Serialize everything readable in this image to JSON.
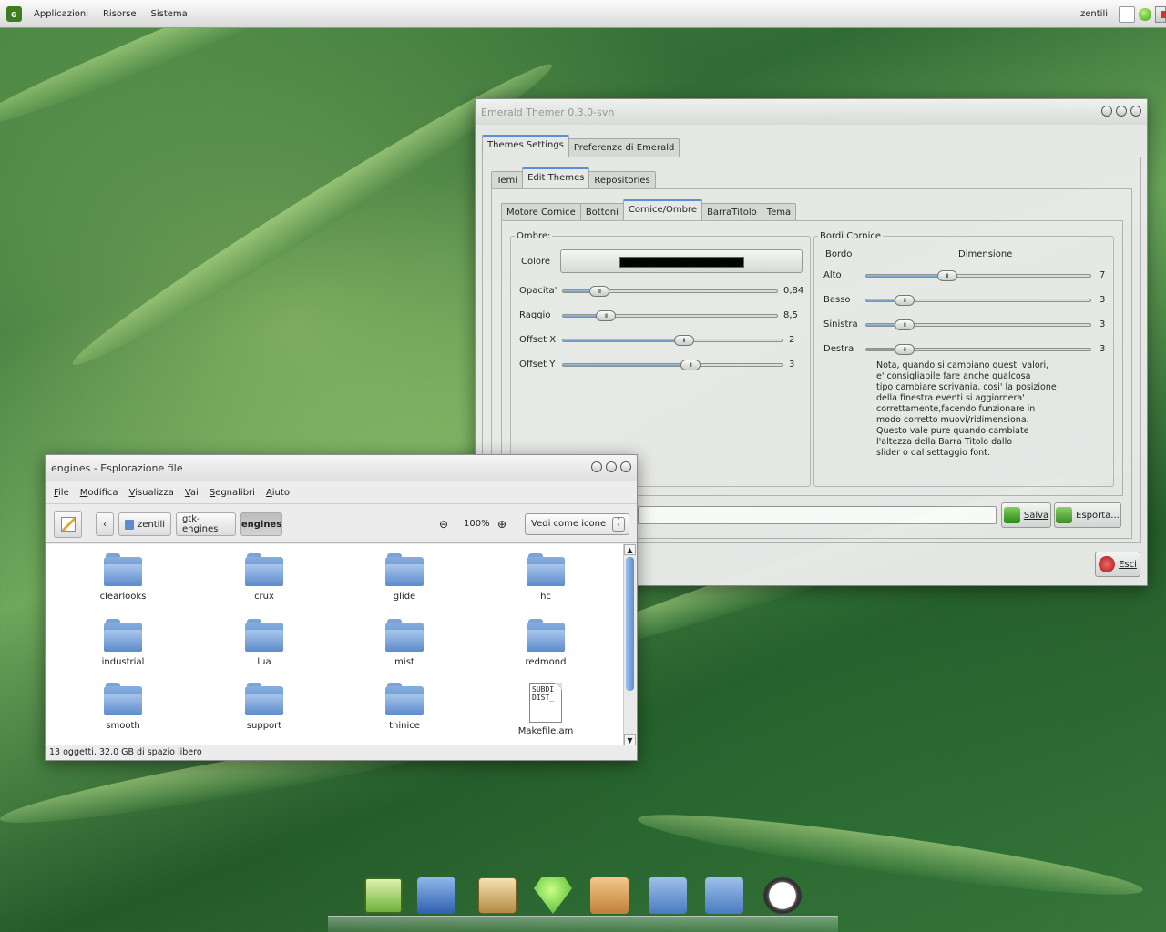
{
  "top_panel": {
    "menus": [
      "Applicazioni",
      "Risorse",
      "Sistema"
    ],
    "user": "zentili"
  },
  "emerald": {
    "title": "Emerald Themer 0.3.0-svn",
    "main_tabs": [
      "Themes Settings",
      "Preferenze di Emerald"
    ],
    "sub_tabs": [
      "Temi",
      "Edit Themes",
      "Repositories"
    ],
    "edit_tabs": [
      "Motore Cornice",
      "Bottoni",
      "Cornice/Ombre",
      "BarraTitolo",
      "Tema"
    ],
    "ombre": {
      "title": "Ombre:",
      "colore_label": "Colore",
      "colore_value": "#000000",
      "sliders": [
        {
          "label": "Opacita'",
          "value": "0,84",
          "fraction": 0.17
        },
        {
          "label": "Raggio",
          "value": "8,5",
          "fraction": 0.2
        },
        {
          "label": "Offset X",
          "value": "2",
          "fraction": 0.55
        },
        {
          "label": "Offset Y",
          "value": "3",
          "fraction": 0.58
        }
      ]
    },
    "bordi": {
      "title": "Bordi Cornice",
      "col_bordo": "Bordo",
      "col_dim": "Dimensione",
      "sliders": [
        {
          "label": "Alto",
          "value": "7",
          "fraction": 0.36
        },
        {
          "label": "Basso",
          "value": "3",
          "fraction": 0.17
        },
        {
          "label": "Sinistra",
          "value": "3",
          "fraction": 0.17
        },
        {
          "label": "Destra",
          "value": "3",
          "fraction": 0.17
        }
      ],
      "note": "Nota, quando si cambiano questi valori,\ne' consigliabile fare anche qualcosa\ntipo cambiare scrivania, cosi' la posizione\ndella finestra eventi si aggiornera'\ncorrettamente,facendo funzionare in\nmodo corretto muovi/ridimensiona.\nQuesto vale pure quando cambiate\nl'altezza della Barra Titolo dallo\nslider o dal settaggio font."
    },
    "buttons": {
      "salva": "Salva",
      "esporta": "Esporta...",
      "esci": "Esci"
    }
  },
  "nautilus": {
    "title": "engines - Esplorazione file",
    "menu": [
      "File",
      "Modifica",
      "Visualizza",
      "Vai",
      "Segnalibri",
      "Aiuto"
    ],
    "path": [
      "zentili",
      "gtk-engines",
      "engines"
    ],
    "back_label": "‹",
    "zoom": "100%",
    "view_mode": "Vedi come icone",
    "files": [
      {
        "name": "clearlooks",
        "type": "folder"
      },
      {
        "name": "crux",
        "type": "folder"
      },
      {
        "name": "glide",
        "type": "folder"
      },
      {
        "name": "hc",
        "type": "folder"
      },
      {
        "name": "industrial",
        "type": "folder"
      },
      {
        "name": "lua",
        "type": "folder"
      },
      {
        "name": "mist",
        "type": "folder"
      },
      {
        "name": "redmond",
        "type": "folder"
      },
      {
        "name": "smooth",
        "type": "folder"
      },
      {
        "name": "support",
        "type": "folder"
      },
      {
        "name": "thinice",
        "type": "folder"
      },
      {
        "name": "Makefile.am",
        "type": "file",
        "preview": "SUBDI\nDIST_"
      }
    ],
    "status": "13 oggetti, 32,0 GB di spazio libero"
  },
  "dock": {
    "icons": [
      "gnome-foot-icon",
      "home-folder-icon",
      "file-cabinet-icon",
      "emerald-gem-icon",
      "package-box-icon",
      "download-folder-icon",
      "folder-icon",
      "clock-icon"
    ]
  },
  "colors": {
    "accent": "#5b8fd6",
    "folder": "#5d8bcb",
    "wallpaper": "#3d7a3d"
  }
}
